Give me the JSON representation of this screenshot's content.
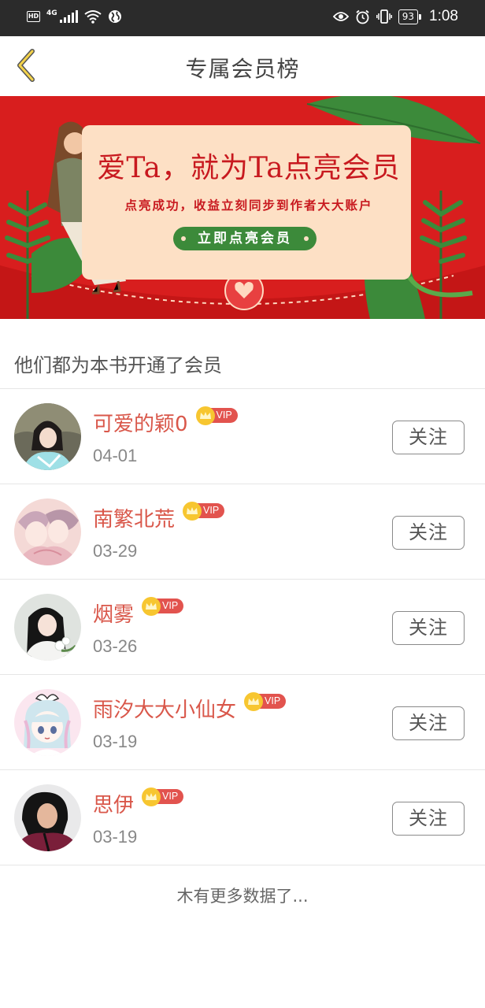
{
  "status_bar": {
    "hd": "HD",
    "network": "4G",
    "battery": "93",
    "time": "1:08"
  },
  "header": {
    "title": "专属会员榜"
  },
  "banner": {
    "headline": "爱Ta，就为Ta点亮会员",
    "subtitle": "点亮成功，收益立刻同步到作者大大账户",
    "cta": "立即点亮会员",
    "colors": {
      "background": "#d81e1e",
      "card": "#fde0c5",
      "button": "#3c8a3a"
    }
  },
  "section": {
    "heading": "他们都为本书开通了会员"
  },
  "members": [
    {
      "name": "可爱的颖0",
      "vip": "VIP",
      "date": "04-01",
      "follow": "关注",
      "avatar_icon": "avatar-girl-hanfu"
    },
    {
      "name": "南繁北荒",
      "vip": "VIP",
      "date": "03-29",
      "follow": "关注",
      "avatar_icon": "avatar-anime-couple"
    },
    {
      "name": "烟雾",
      "vip": "VIP",
      "date": "03-26",
      "follow": "关注",
      "avatar_icon": "avatar-girl-flowers"
    },
    {
      "name": "雨汐大大小仙女",
      "vip": "VIP",
      "date": "03-19",
      "follow": "关注",
      "avatar_icon": "avatar-cartoon-girl"
    },
    {
      "name": "思伊",
      "vip": "VIP",
      "date": "03-19",
      "follow": "关注",
      "avatar_icon": "avatar-woman-photo"
    }
  ],
  "footer": {
    "note": "木有更多数据了..."
  },
  "theme": {
    "accent_name": "#d9574a",
    "vip_badge": "#e2534e",
    "crown": "#f7c630"
  }
}
